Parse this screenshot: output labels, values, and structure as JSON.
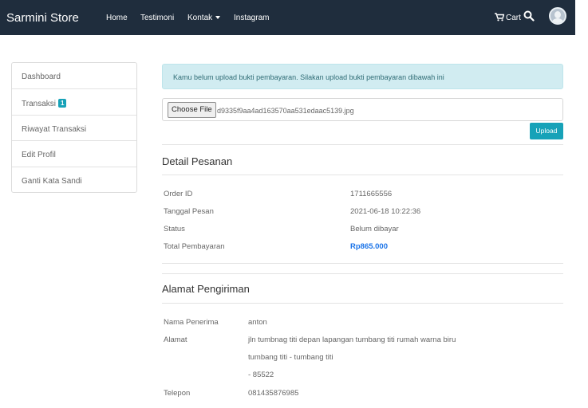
{
  "navbar": {
    "brand": "Sarmini Store",
    "links": [
      "Home",
      "Testimoni",
      "Kontak",
      "Instagram"
    ],
    "cart_label": "Cart",
    "icons": [
      "cart-icon",
      "search-icon",
      "avatar"
    ]
  },
  "sidebar": {
    "items": [
      {
        "label": "Dashboard"
      },
      {
        "label": "Transaksi",
        "badge": "1"
      },
      {
        "label": "Riwayat Transaksi"
      },
      {
        "label": "Edit Profil"
      },
      {
        "label": "Ganti Kata Sandi"
      }
    ]
  },
  "alert": {
    "text": "Kamu belum upload bukti pembayaran. Silakan upload bukti pembayaran dibawah ini"
  },
  "upload": {
    "choose_label": "Choose File",
    "file_name": "d9335f9aa4ad163570aa531edaac5139.jpg",
    "button_label": "Upload"
  },
  "order": {
    "title": "Detail Pesanan",
    "rows": [
      {
        "label": "Order ID",
        "value": "1711665556"
      },
      {
        "label": "Tanggal Pesan",
        "value": "2021-06-18 10:22:36"
      },
      {
        "label": "Status",
        "value": "Belum dibayar"
      },
      {
        "label": "Total Pembayaran",
        "value": "Rp865.000"
      }
    ]
  },
  "shipping": {
    "title": "Alamat Pengiriman",
    "recipient_label": "Nama Penerima",
    "recipient": "anton",
    "address_label": "Alamat",
    "address_line1": "jln tumbnag titi depan lapangan tumbang titi rumah warna biru",
    "address_line2": "tumbang titi - tumbang titi",
    "address_line3": "- 85522",
    "phone_label": "Telepon",
    "phone": "081435876985"
  },
  "colors": {
    "navbar": "#1f2d3d",
    "accent": "#17a2b8",
    "alert_bg": "#d1ecf1",
    "total": "#1a73e8"
  }
}
